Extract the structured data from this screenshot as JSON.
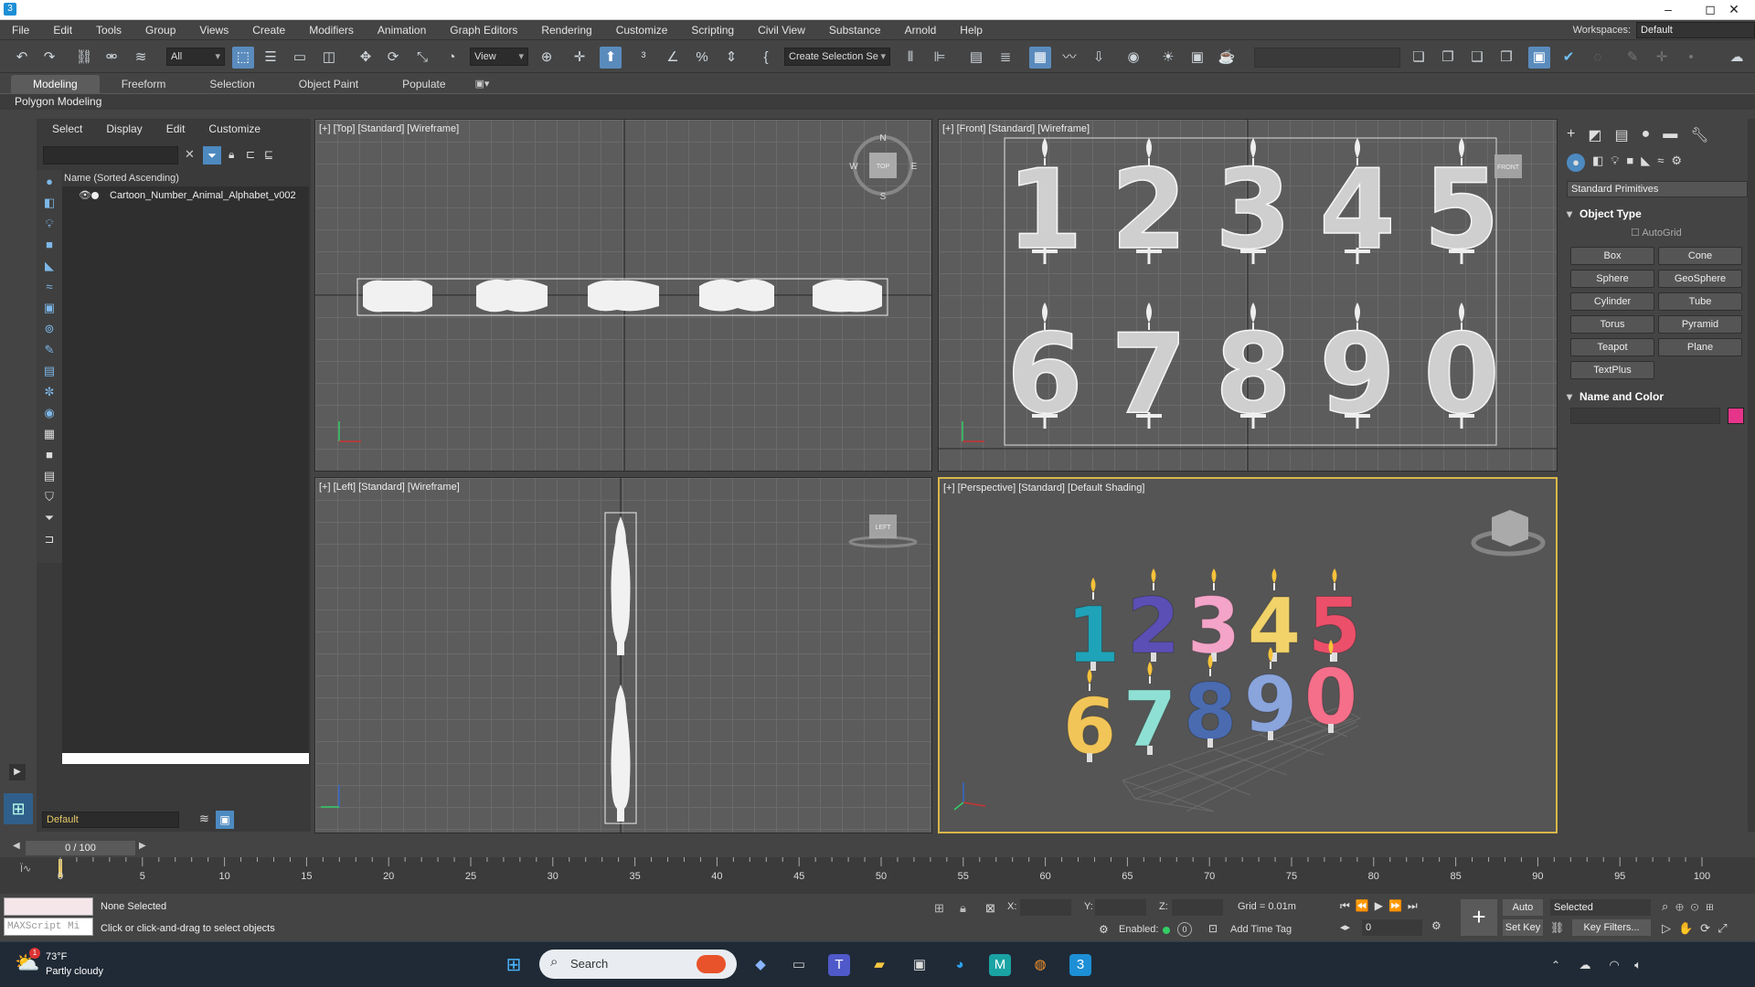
{
  "titlebar": {
    "minimize": "–",
    "maximize": "◻",
    "close": "✕"
  },
  "menu": [
    "File",
    "Edit",
    "Tools",
    "Group",
    "Views",
    "Create",
    "Modifiers",
    "Animation",
    "Graph Editors",
    "Rendering",
    "Customize",
    "Scripting",
    "Civil View",
    "Substance",
    "Arnold",
    "Help"
  ],
  "workspaces": {
    "label": "Workspaces:",
    "value": "Default"
  },
  "toolbar": {
    "selection_filter": "All",
    "ref_coord": "View",
    "named_selection": "Create Selection Se"
  },
  "ribbon": {
    "tabs": [
      "Modeling",
      "Freeform",
      "Selection",
      "Object Paint",
      "Populate"
    ],
    "active": "Modeling",
    "sub": "Polygon Modeling"
  },
  "explorer": {
    "menu": [
      "Select",
      "Display",
      "Edit",
      "Customize"
    ],
    "column_header": "Name (Sorted Ascending)",
    "items": [
      "Cartoon_Number_Animal_Alphabet_v002"
    ],
    "layer": "Default"
  },
  "viewports": {
    "top": "[+] [Top] [Standard] [Wireframe]",
    "front": "[+] [Front] [Standard] [Wireframe]",
    "left": "[+] [Left] [Standard] [Wireframe]",
    "perspective": "[+] [Perspective] [Standard] [Default Shading]"
  },
  "front_digits": [
    "1",
    "2",
    "3",
    "4",
    "5",
    "6",
    "7",
    "8",
    "9",
    "0"
  ],
  "persp_digits": [
    {
      "d": "1",
      "color": "#1fa3b8"
    },
    {
      "d": "2",
      "color": "#5b4fb5"
    },
    {
      "d": "3",
      "color": "#f3a4c8"
    },
    {
      "d": "4",
      "color": "#f2d36a"
    },
    {
      "d": "5",
      "color": "#ec4f6a"
    },
    {
      "d": "6",
      "color": "#f2c558"
    },
    {
      "d": "7",
      "color": "#8fe0d4"
    },
    {
      "d": "8",
      "color": "#4a6bb0"
    },
    {
      "d": "9",
      "color": "#8aa4dc"
    },
    {
      "d": "0",
      "color": "#f56f8a"
    }
  ],
  "compass": {
    "n": "N",
    "s": "S",
    "e": "E",
    "w": "W",
    "top": "TOP",
    "front": "FRONT",
    "left": "LEFT"
  },
  "command_panel": {
    "category": "Standard Primitives",
    "object_type_title": "Object Type",
    "autogrid": "AutoGrid",
    "primitives": [
      "Box",
      "Cone",
      "Sphere",
      "GeoSphere",
      "Cylinder",
      "Tube",
      "Torus",
      "Pyramid",
      "Teapot",
      "Plane",
      "TextPlus"
    ],
    "name_color_title": "Name and Color",
    "swatch": "#e6348a"
  },
  "timeline": {
    "frame": "0 / 100",
    "ticks": [
      "0",
      "5",
      "10",
      "15",
      "20",
      "25",
      "30",
      "35",
      "40",
      "45",
      "50",
      "55",
      "60",
      "65",
      "70",
      "75",
      "80",
      "85",
      "90",
      "95",
      "100"
    ]
  },
  "status": {
    "maxscript": "MAXScript Mi",
    "selection": "None Selected",
    "prompt": "Click or click-and-drag to select objects",
    "x_label": "X:",
    "y_label": "Y:",
    "z_label": "Z:",
    "grid": "Grid = 0.01m",
    "enabled": "Enabled:",
    "add_time_tag": "Add Time Tag",
    "auto_key": "Auto Key",
    "set_key": "Set Key",
    "selected": "Selected",
    "key_filters": "Key Filters...",
    "frame_field": "0"
  },
  "taskbar": {
    "temp": "73°F",
    "weather": "Partly cloudy",
    "search": "Search",
    "badge": "1"
  }
}
